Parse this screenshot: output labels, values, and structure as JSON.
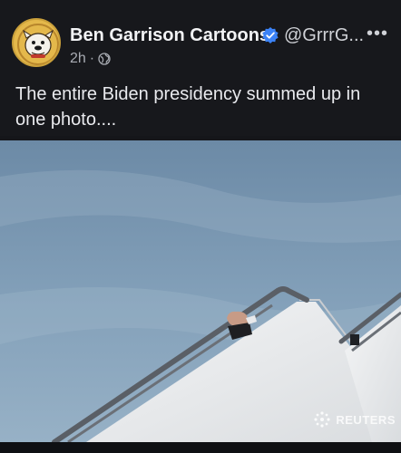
{
  "post": {
    "author": "Ben Garrison Cartoons",
    "handle": "@GrrrG...",
    "more": "•••",
    "time": "2h",
    "separator": "·",
    "text": "The entire Biden presidency summed up in one photo....",
    "photo_credit": "REUTERS"
  },
  "colors": {
    "verified": "#3b82f6",
    "background": "#15161a"
  },
  "icons": {
    "verified": "verified-badge-icon",
    "privacy": "globe-icon",
    "more": "more-options-icon",
    "credit": "reuters-logo-icon"
  }
}
